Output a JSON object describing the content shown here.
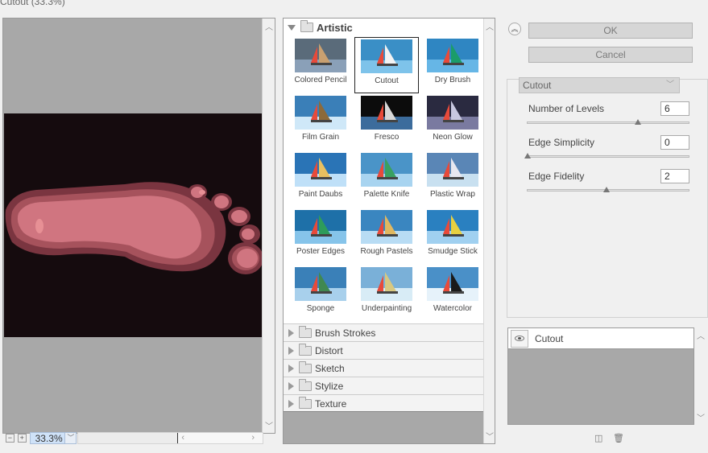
{
  "window": {
    "title": "Cutout (33.3%)"
  },
  "preview": {
    "zoom_value": "33.3%",
    "zoom_out_label": "−",
    "zoom_in_label": "+"
  },
  "gallery": {
    "open_category": "Artistic",
    "filters": [
      {
        "label": "Colored Pencil",
        "selected": false
      },
      {
        "label": "Cutout",
        "selected": true
      },
      {
        "label": "Dry Brush",
        "selected": false
      },
      {
        "label": "Film Grain",
        "selected": false
      },
      {
        "label": "Fresco",
        "selected": false
      },
      {
        "label": "Neon Glow",
        "selected": false
      },
      {
        "label": "Paint Daubs",
        "selected": false
      },
      {
        "label": "Palette Knife",
        "selected": false
      },
      {
        "label": "Plastic Wrap",
        "selected": false
      },
      {
        "label": "Poster Edges",
        "selected": false
      },
      {
        "label": "Rough Pastels",
        "selected": false
      },
      {
        "label": "Smudge Stick",
        "selected": false
      },
      {
        "label": "Sponge",
        "selected": false
      },
      {
        "label": "Underpainting",
        "selected": false
      },
      {
        "label": "Watercolor",
        "selected": false
      }
    ],
    "collapsed_categories": [
      "Brush Strokes",
      "Distort",
      "Sketch",
      "Stylize",
      "Texture"
    ]
  },
  "actions": {
    "ok": "OK",
    "cancel": "Cancel"
  },
  "settings": {
    "selected_filter": "Cutout",
    "params": [
      {
        "label": "Number of Levels",
        "value": "6",
        "level": 0.7
      },
      {
        "label": "Edge Simplicity",
        "value": "0",
        "level": 0.0
      },
      {
        "label": "Edge Fidelity",
        "value": "2",
        "level": 0.5
      }
    ]
  },
  "layers": {
    "items": [
      {
        "name": "Cutout"
      }
    ]
  },
  "colors": {
    "preview_bg": "#150b0e",
    "foot_outer": "#7a3540",
    "foot_mid": "#a6525c",
    "foot_inner": "#d07580",
    "foot_highlight": "#e79095"
  }
}
